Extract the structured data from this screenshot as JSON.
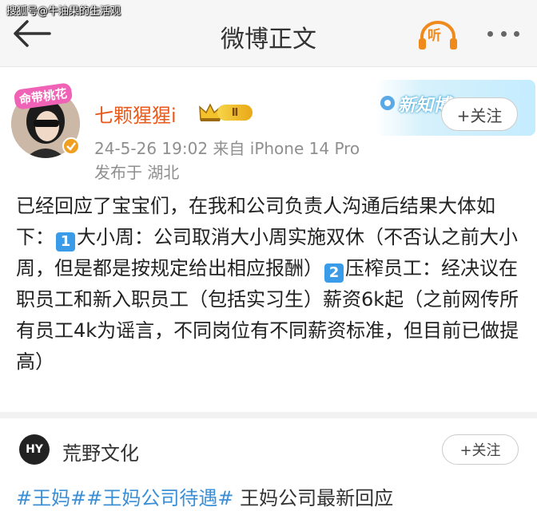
{
  "watermark": "搜狐号@牛油果的生活观",
  "nav": {
    "title": "微博正文",
    "listen_label": "听",
    "icons": {
      "back": "back-arrow-icon",
      "listen": "headphones-icon",
      "more": "more-dots-icon"
    }
  },
  "post": {
    "avatar_frame_label": "命带桃花",
    "username": "七颗猩猩i",
    "vip_level": "Ⅱ",
    "time_source": "24-5-26 19:02  来自 iPhone 14 Pro",
    "location": "发布于 湖北",
    "promo_text": "新知博",
    "follow_label": "+关注",
    "body": {
      "p1": "已经回应了宝宝们，在我和公司负责人沟通后结果大体如下：",
      "k1": "1",
      "p2": "大小周：公司取消大小周实施双休（不否认之前大小周，但是都是按规定给出相应报酬）",
      "k2": "2",
      "p3": "压榨员工：经决议在职员工和新入职员工（包括实习生）薪资6k起（之前网传所有员工4k为谣言，不同岗位有不同薪资标准，但目前已做提高）"
    }
  },
  "repost": {
    "org_logo_text": "HY",
    "org_name": "荒野文化",
    "follow_label": "+关注",
    "topics": [
      {
        "text": "#王妈#",
        "link": true
      },
      {
        "text": "#王妈公司待遇#",
        "link": true
      },
      {
        "text": " 王妈公司最新回应",
        "link": false
      }
    ]
  },
  "colors": {
    "username": "#e8591c",
    "topic_link": "#3b8fd6",
    "listen_orange": "#f08a1c",
    "meta_gray": "#8f8f8f"
  }
}
